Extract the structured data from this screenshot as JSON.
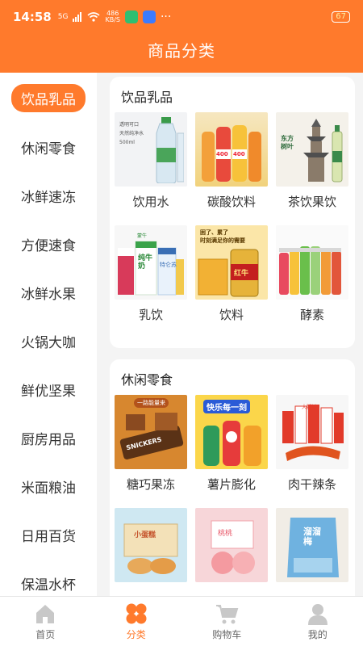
{
  "status": {
    "time": "14:58",
    "signal": "5G",
    "speed_value": "486",
    "speed_unit": "KB/S",
    "more": "···",
    "battery": "67"
  },
  "header": {
    "title": "商品分类"
  },
  "sidebar": {
    "items": [
      {
        "label": "饮品乳品"
      },
      {
        "label": "休闲零食"
      },
      {
        "label": "冰鲜速冻"
      },
      {
        "label": "方便速食"
      },
      {
        "label": "冰鲜水果"
      },
      {
        "label": "火锅大咖"
      },
      {
        "label": "鲜优坚果"
      },
      {
        "label": "厨房用品"
      },
      {
        "label": "米面粮油"
      },
      {
        "label": "日用百货"
      },
      {
        "label": "保温水杯"
      }
    ],
    "active_index": 0
  },
  "sections": [
    {
      "title": "饮品乳品",
      "items": [
        {
          "label": "饮用水",
          "image_text": [
            "透明可口",
            "天然纯净水",
            "500ml"
          ]
        },
        {
          "label": "碳酸饮料",
          "image_text": [
            "400",
            "400"
          ]
        },
        {
          "label": "茶饮果饮",
          "image_text": [
            "东方",
            "树叶"
          ]
        },
        {
          "label": "乳饮",
          "image_text": [
            "蒙牛",
            "纯牛奶",
            "特仑苏"
          ]
        },
        {
          "label": "饮料",
          "image_text": [
            "困了、累了",
            "时刻满足你的需要",
            "红牛"
          ]
        },
        {
          "label": "酵素",
          "image_text": []
        }
      ]
    },
    {
      "title": "休闲零食",
      "items": [
        {
          "label": "糖巧果冻",
          "image_text": [
            "一路能量来",
            "SNICKERS"
          ]
        },
        {
          "label": "薯片膨化",
          "image_text": [
            "快乐每一刻"
          ]
        },
        {
          "label": "肉干辣条",
          "image_text": [
            "大脚板"
          ]
        },
        {
          "label": "",
          "image_text": [
            "小蛋糕"
          ]
        },
        {
          "label": "",
          "image_text": [
            "桃桃"
          ]
        },
        {
          "label": "",
          "image_text": [
            "溜溜梅"
          ]
        }
      ]
    }
  ],
  "bottom_nav": {
    "items": [
      {
        "label": "首页",
        "icon": "home-icon"
      },
      {
        "label": "分类",
        "icon": "category-icon"
      },
      {
        "label": "购物车",
        "icon": "cart-icon"
      },
      {
        "label": "我的",
        "icon": "user-icon"
      }
    ],
    "active_index": 1
  },
  "colors": {
    "accent": "#ff7a2c",
    "inactive": "#c8c8c8"
  }
}
